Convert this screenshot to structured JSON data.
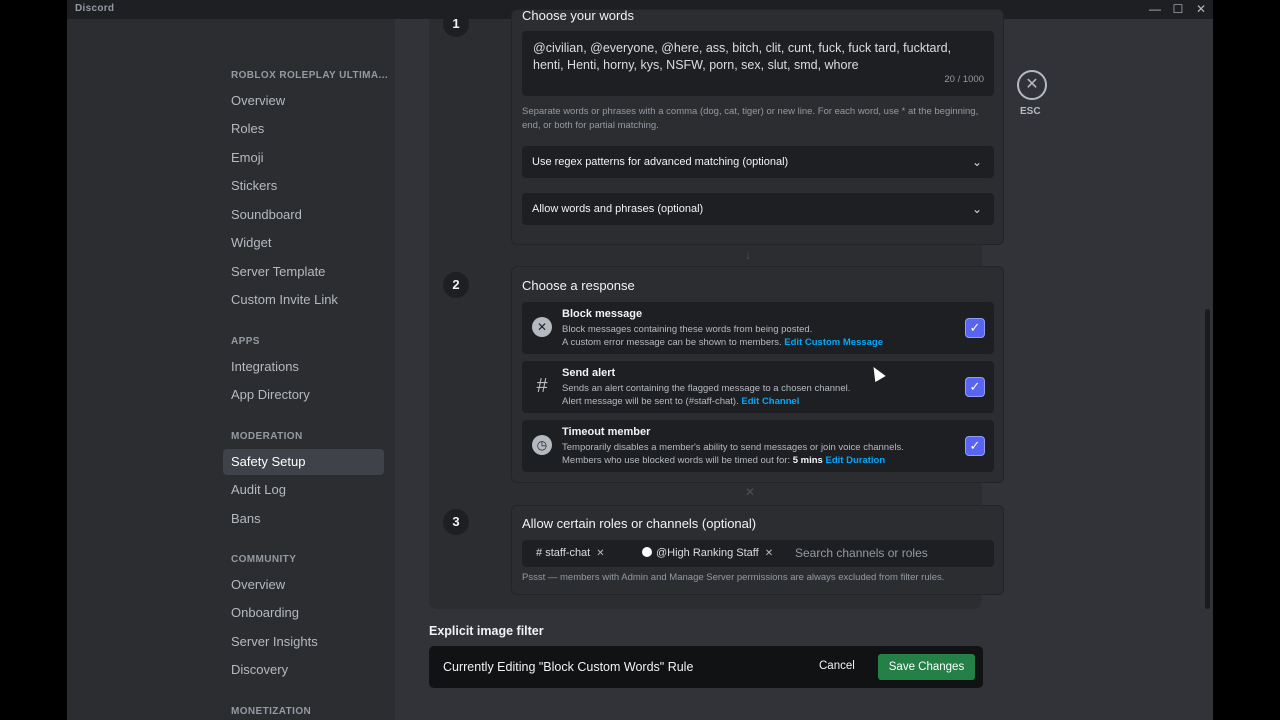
{
  "window": {
    "app_name": "Discord",
    "controls": [
      "—",
      "☐",
      "✕"
    ]
  },
  "sidebar": {
    "server_heading": "ROBLOX ROLEPLAY ULTIMA...",
    "server_items": [
      "Overview",
      "Roles",
      "Emoji",
      "Stickers",
      "Soundboard",
      "Widget",
      "Server Template",
      "Custom Invite Link"
    ],
    "apps_heading": "APPS",
    "apps_items": [
      "Integrations",
      "App Directory"
    ],
    "moderation_heading": "MODERATION",
    "moderation_items": [
      "Safety Setup",
      "Audit Log",
      "Bans"
    ],
    "community_heading": "COMMUNITY",
    "community_items": [
      "Overview",
      "Onboarding",
      "Server Insights",
      "Discovery"
    ],
    "monetization_heading": "MONETIZATION",
    "active_item": "Safety Setup"
  },
  "step1": {
    "number": "1",
    "title": "Choose your words",
    "words": "@civilian, @everyone, @here, ass, bitch, clit, cunt, fuck, fuck tard, fucktard, henti, Henti, horny, kys, NSFW, porn, sex, slut, smd, whore",
    "counter": "20 / 1000",
    "hint": "Separate words or phrases with a comma (dog, cat, tiger) or new line. For each word, use * at the beginning, end, or both for partial matching.",
    "regex_label": "Use regex patterns for advanced matching (optional)",
    "allow_label": "Allow words and phrases (optional)"
  },
  "step2": {
    "number": "2",
    "title": "Choose a response",
    "block": {
      "title": "Block message",
      "line1": "Block messages containing these words from being posted.",
      "line2": "A custom error message can be shown to members.",
      "link": "Edit Custom Message",
      "checked": true
    },
    "alert": {
      "title": "Send alert",
      "line1": "Sends an alert containing the flagged message to a chosen channel.",
      "line2": "Alert message will be sent to (#staff-chat).",
      "link": "Edit Channel",
      "checked": true
    },
    "timeout": {
      "title": "Timeout member",
      "line1": "Temporarily disables a member's ability to send messages or join voice channels.",
      "line2": "Members who use blocked words will be timed out for:",
      "duration": "5 mins",
      "link": "Edit Duration",
      "checked": true
    }
  },
  "step3": {
    "number": "3",
    "title": "Allow certain roles or channels (optional)",
    "chip_channel": "staff-chat",
    "chip_role": "@High Ranking Staff",
    "search_placeholder": "Search channels or roles",
    "hint": "Pssst — members with Admin and Manage Server permissions are always excluded from filter rules."
  },
  "esc": {
    "label": "ESC"
  },
  "next_section_title": "Explicit image filter",
  "notice": {
    "text": "Currently Editing \"Block Custom Words\" Rule",
    "cancel": "Cancel",
    "save": "Save Changes"
  },
  "colors": {
    "accent": "#5865f2",
    "save_green": "#248046",
    "link": "#00a8fc"
  }
}
